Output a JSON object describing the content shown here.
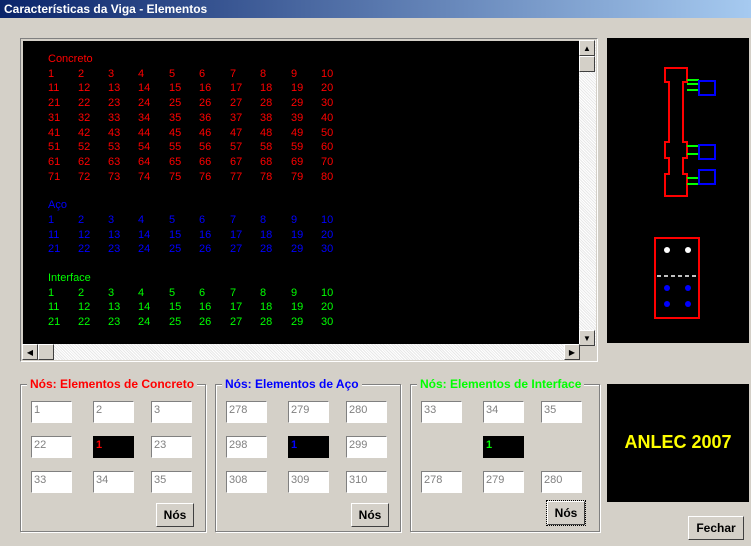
{
  "window": {
    "title": "Características da Viga - Elementos"
  },
  "list": {
    "concrete_header": "Concreto",
    "concrete_rows": [
      [
        "1",
        "2",
        "3",
        "4",
        "5",
        "6",
        "7",
        "8",
        "9",
        "10"
      ],
      [
        "11",
        "12",
        "13",
        "14",
        "15",
        "16",
        "17",
        "18",
        "19",
        "20"
      ],
      [
        "21",
        "22",
        "23",
        "24",
        "25",
        "26",
        "27",
        "28",
        "29",
        "30"
      ],
      [
        "31",
        "32",
        "33",
        "34",
        "35",
        "36",
        "37",
        "38",
        "39",
        "40"
      ],
      [
        "41",
        "42",
        "43",
        "44",
        "45",
        "46",
        "47",
        "48",
        "49",
        "50"
      ],
      [
        "51",
        "52",
        "53",
        "54",
        "55",
        "56",
        "57",
        "58",
        "59",
        "60"
      ],
      [
        "61",
        "62",
        "63",
        "64",
        "65",
        "66",
        "67",
        "68",
        "69",
        "70"
      ],
      [
        "71",
        "72",
        "73",
        "74",
        "75",
        "76",
        "77",
        "78",
        "79",
        "80"
      ]
    ],
    "steel_header": "Aço",
    "steel_rows": [
      [
        "1",
        "2",
        "3",
        "4",
        "5",
        "6",
        "7",
        "8",
        "9",
        "10"
      ],
      [
        "11",
        "12",
        "13",
        "14",
        "15",
        "16",
        "17",
        "18",
        "19",
        "20"
      ],
      [
        "21",
        "22",
        "23",
        "24",
        "25",
        "26",
        "27",
        "28",
        "29",
        "30"
      ]
    ],
    "interface_header": "Interface",
    "interface_rows": [
      [
        "1",
        "2",
        "3",
        "4",
        "5",
        "6",
        "7",
        "8",
        "9",
        "10"
      ],
      [
        "11",
        "12",
        "13",
        "14",
        "15",
        "16",
        "17",
        "18",
        "19",
        "20"
      ],
      [
        "21",
        "22",
        "23",
        "24",
        "25",
        "26",
        "27",
        "28",
        "29",
        "30"
      ]
    ]
  },
  "colors": {
    "concrete": "#ff0000",
    "steel": "#0000ff",
    "interface": "#00ff00",
    "logo": "#ffff00"
  },
  "groups": {
    "concrete": {
      "title": "Nós: Elementos de Concreto",
      "grid": [
        "1",
        "2",
        "3",
        "22",
        "1",
        "23",
        "33",
        "34",
        "35"
      ],
      "button": "Nós"
    },
    "steel": {
      "title": "Nós: Elementos de Aço",
      "grid": [
        "278",
        "279",
        "280",
        "298",
        "1",
        "299",
        "308",
        "309",
        "310"
      ],
      "button": "Nós"
    },
    "interface": {
      "title": "Nós: Elementos de Interface",
      "grid": [
        "33",
        "34",
        "35",
        "",
        "1",
        "",
        "278",
        "279",
        "280"
      ],
      "button": "Nós"
    }
  },
  "logo": {
    "text": "ANLEC 2007"
  },
  "close_button": "Fechar"
}
